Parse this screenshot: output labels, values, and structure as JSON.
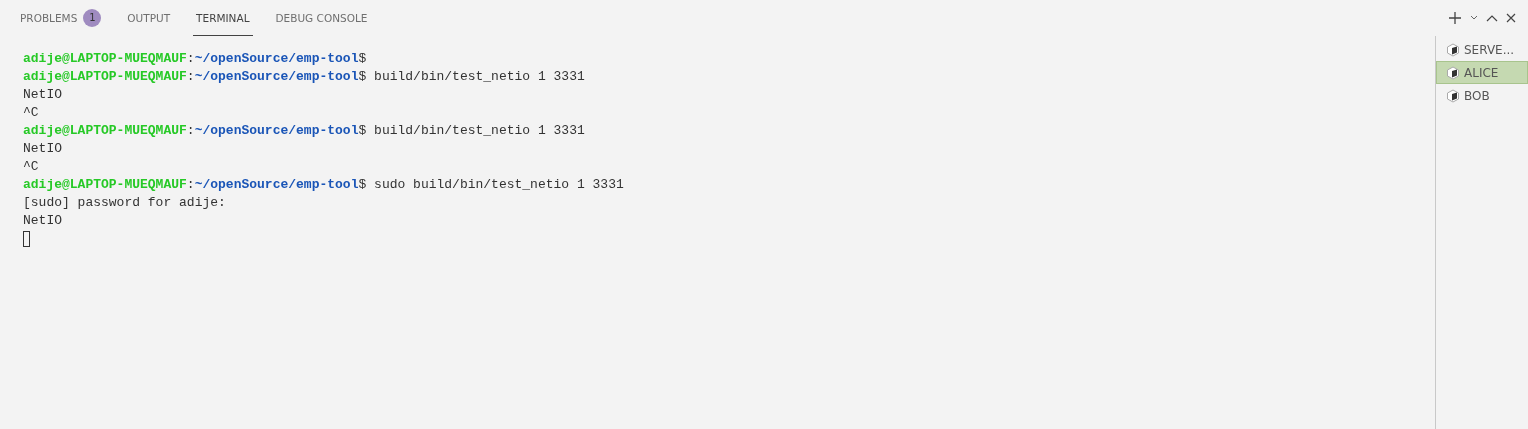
{
  "tabs": [
    {
      "label": "PROBLEMS",
      "badge": "1",
      "selected": false
    },
    {
      "label": "OUTPUT",
      "selected": false
    },
    {
      "label": "TERMINAL",
      "selected": true
    },
    {
      "label": "DEBUG CONSOLE",
      "selected": false
    }
  ],
  "terminal": {
    "lines": [
      {
        "kind": "prompt",
        "user": "adije@LAPTOP-MUEQMAUF",
        "sep": ":",
        "path": "~/openSource/emp-tool",
        "dollar": "$"
      },
      {
        "kind": "prompt",
        "user": "adije@LAPTOP-MUEQMAUF",
        "sep": ":",
        "path": "~/openSource/emp-tool",
        "dollar": "$",
        "command": "build/bin/test_netio 1 3331"
      },
      {
        "kind": "output",
        "text": "NetIO"
      },
      {
        "kind": "output",
        "text": "^C"
      },
      {
        "kind": "prompt",
        "user": "adije@LAPTOP-MUEQMAUF",
        "sep": ":",
        "path": "~/openSource/emp-tool",
        "dollar": "$",
        "command": "build/bin/test_netio 1 3331"
      },
      {
        "kind": "output",
        "text": "NetIO"
      },
      {
        "kind": "output",
        "text": "^C"
      },
      {
        "kind": "prompt",
        "user": "adije@LAPTOP-MUEQMAUF",
        "sep": ":",
        "path": "~/openSource/emp-tool",
        "dollar": "$",
        "command": "sudo build/bin/test_netio 1 3331"
      },
      {
        "kind": "output",
        "text": "[sudo] password for adije:"
      },
      {
        "kind": "output",
        "text": "NetIO"
      },
      {
        "kind": "cursor"
      }
    ]
  },
  "sessions": [
    {
      "label": "SERVE...",
      "selected": false
    },
    {
      "label": "ALICE",
      "selected": true
    },
    {
      "label": "BOB",
      "selected": false
    }
  ]
}
